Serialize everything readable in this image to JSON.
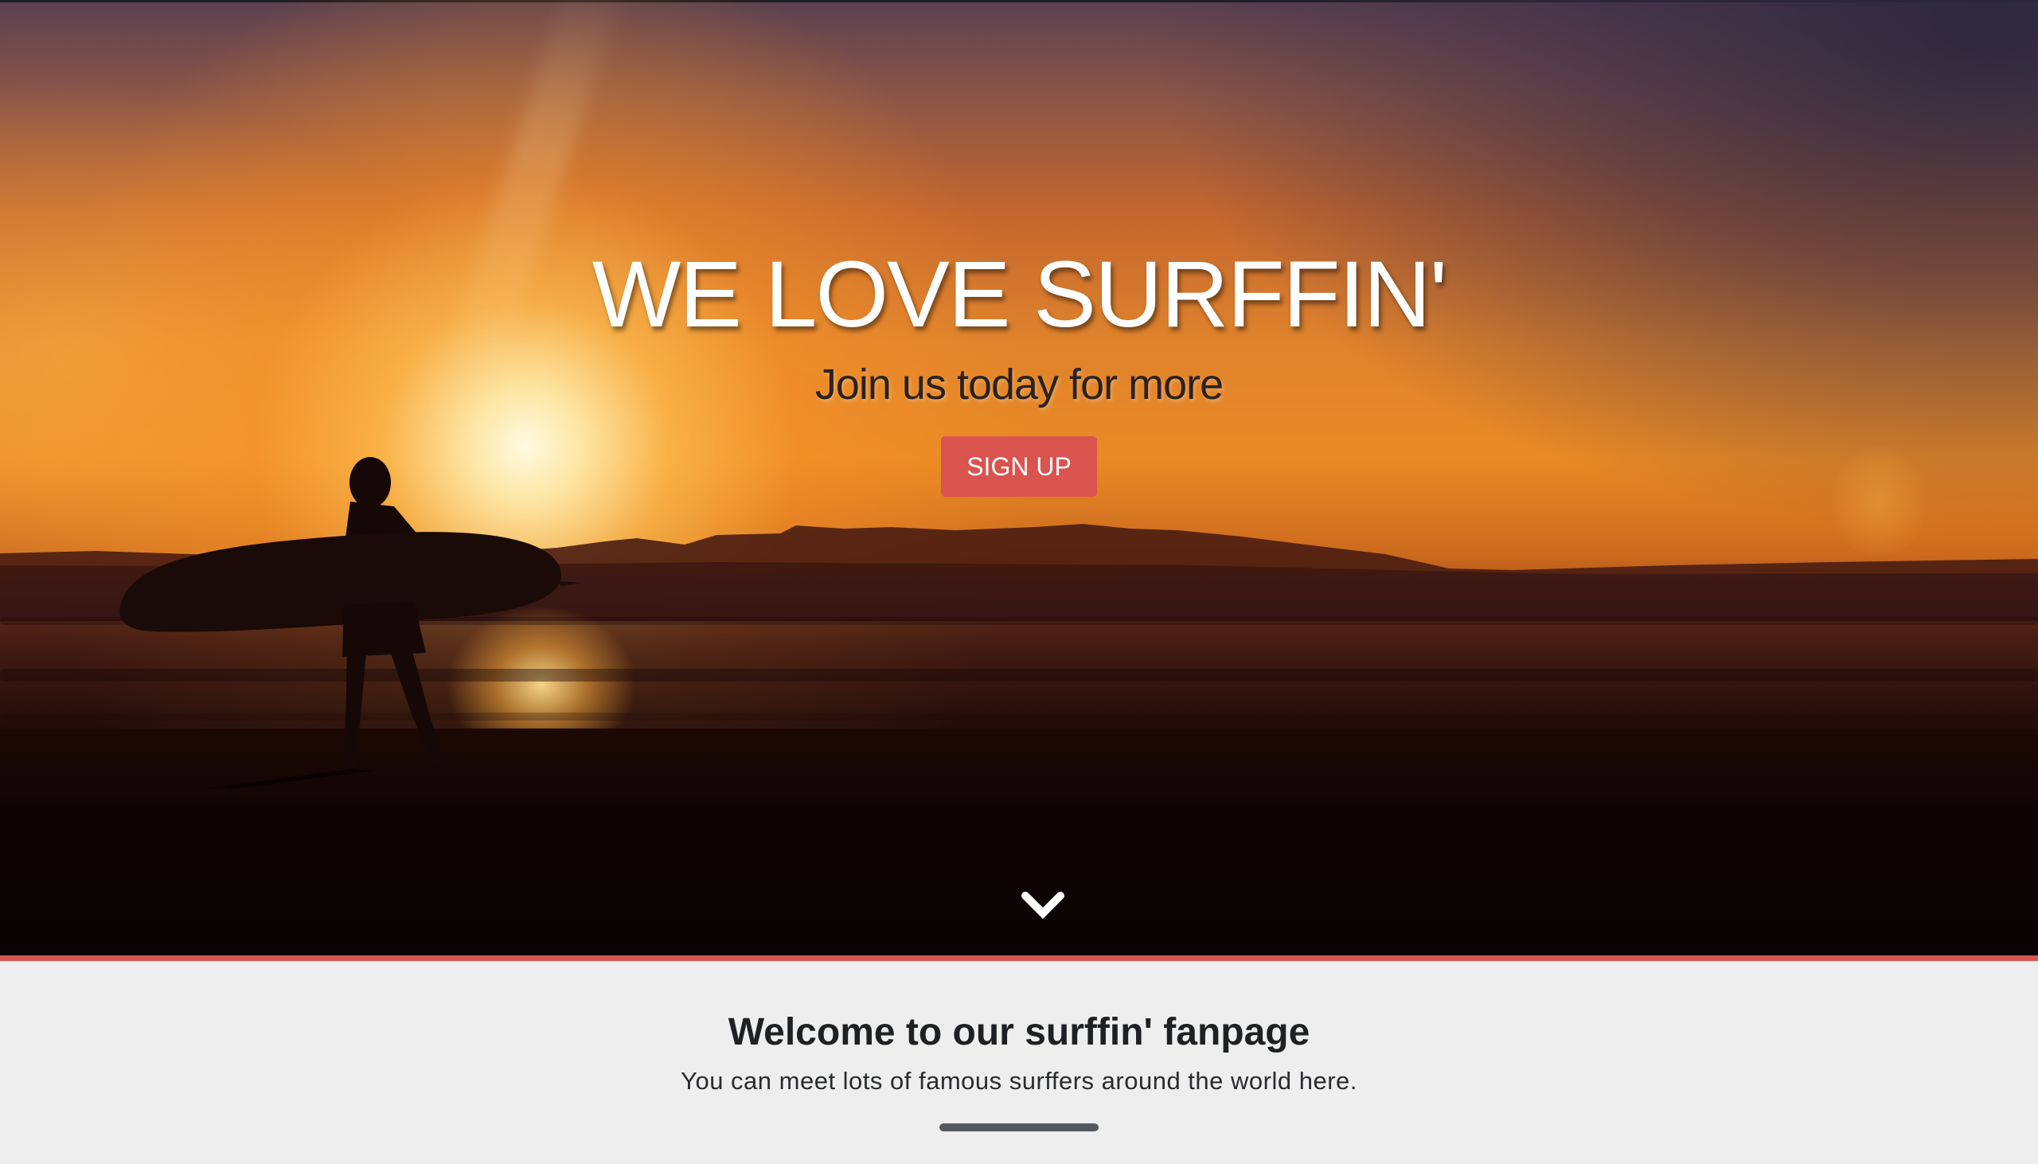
{
  "hero": {
    "title": "WE LOVE SURFFIN'",
    "subtitle": "Join us today for more",
    "signup_label": "SIGN UP",
    "scroll_icon": "chevron-down-icon",
    "background_image": "sunset-surfer-on-beach",
    "accent_color": "#d9534f"
  },
  "welcome": {
    "title": "Welcome to our surffin' fanpage",
    "text": "You can meet lots of famous surffers around the world here."
  }
}
